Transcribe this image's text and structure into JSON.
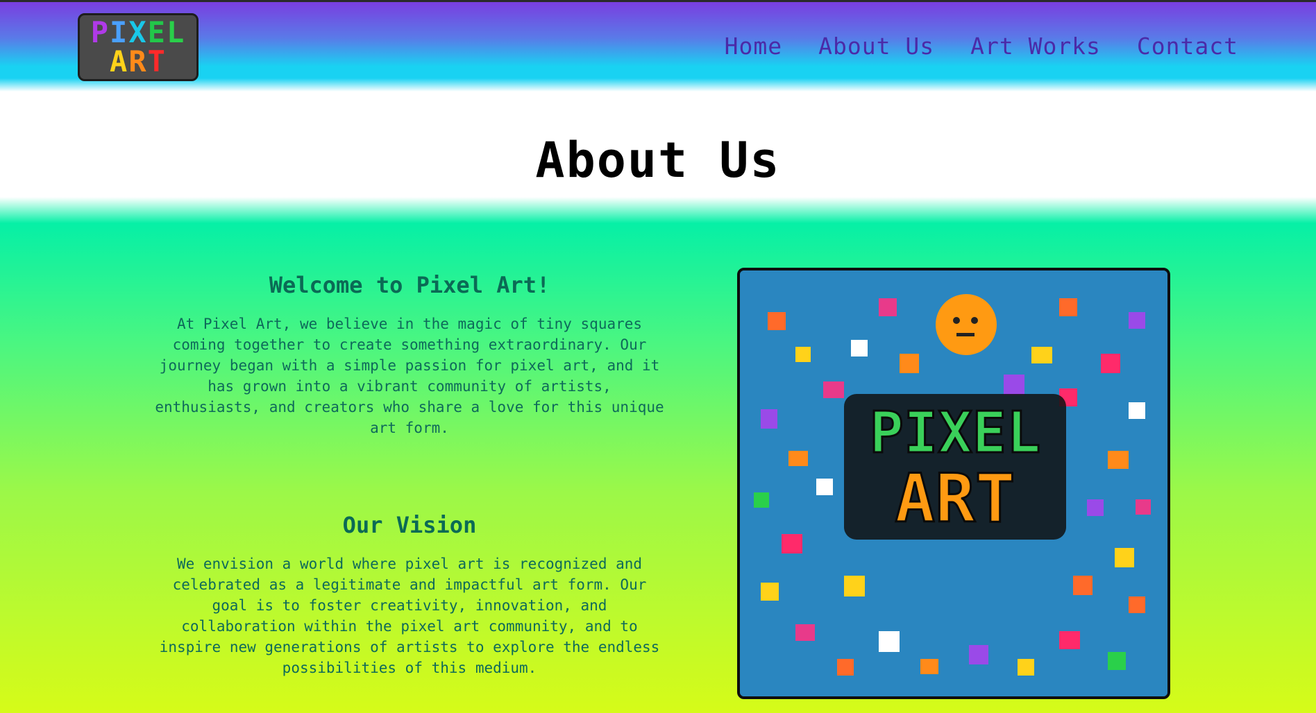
{
  "header": {
    "logo": {
      "line1": "PIXEL",
      "line2": "ART",
      "colors": [
        "#b03ae8",
        "#4aa0ff",
        "#19c8e8",
        "#22c84a",
        "#2ad04a",
        "#ffd21a",
        "#ff8a1a",
        "#ff2a2a"
      ]
    },
    "nav": [
      {
        "label": "Home"
      },
      {
        "label": "About Us"
      },
      {
        "label": "Art Works"
      },
      {
        "label": "Contact"
      }
    ]
  },
  "page": {
    "title": "About Us"
  },
  "sections": {
    "welcome": {
      "heading": "Welcome to Pixel Art!",
      "body": "At Pixel Art, we believe in the magic of tiny squares coming together to create something extraordinary. Our journey began with a simple passion for pixel art, and it has grown into a vibrant community of artists, enthusiasts, and creators who share a love for this unique art form."
    },
    "vision": {
      "heading": "Our Vision",
      "body": "We envision a world where pixel art is recognized and celebrated as a legitimate and impactful art form. Our goal is to foster creativity, innovation, and collaboration within the pixel art community, and to inspire new generations of artists to explore the endless possibilities of this medium."
    }
  },
  "poster": {
    "line1": "PIXEL",
    "line2": "ART",
    "background": "#2a86c0"
  },
  "colors": {
    "nav_text": "#4b2aa8",
    "section_text": "#0e6a5a",
    "title": "#000000"
  }
}
